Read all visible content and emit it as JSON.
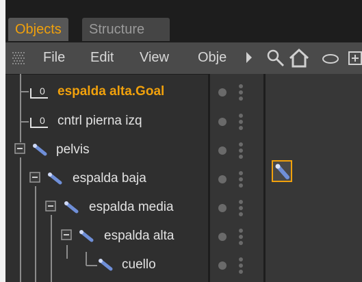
{
  "tabs": [
    {
      "label": "Objects",
      "active": true
    },
    {
      "label": "Structure",
      "active": false
    }
  ],
  "menu": [
    "File",
    "Edit",
    "View",
    "Obje"
  ],
  "toolbar_icons": [
    "search-icon",
    "home-icon",
    "eye-icon",
    "add-icon"
  ],
  "objects": [
    {
      "name": "espalda alta.Goal",
      "icon": "null-object-icon",
      "icon_label": "0",
      "level": 0,
      "goal": true
    },
    {
      "name": "cntrl pierna izq",
      "icon": "null-object-icon",
      "icon_label": "0",
      "level": 0,
      "goal": false
    },
    {
      "name": "pelvis",
      "icon": "joint-icon",
      "level": 0,
      "goal": false
    },
    {
      "name": "espalda baja",
      "icon": "joint-icon",
      "level": 1,
      "goal": false
    },
    {
      "name": "espalda media",
      "icon": "joint-icon",
      "level": 2,
      "goal": false
    },
    {
      "name": "espalda alta",
      "icon": "joint-icon",
      "level": 3,
      "goal": false
    },
    {
      "name": "cuello",
      "icon": "joint-icon",
      "level": 4,
      "goal": false
    }
  ],
  "tags": [
    {
      "row": 3,
      "icon": "ik-tag-icon",
      "selected": true
    }
  ],
  "colors": {
    "accent": "#f1a10c",
    "panel": "#2f2f2f",
    "text": "#e2e2e2"
  }
}
